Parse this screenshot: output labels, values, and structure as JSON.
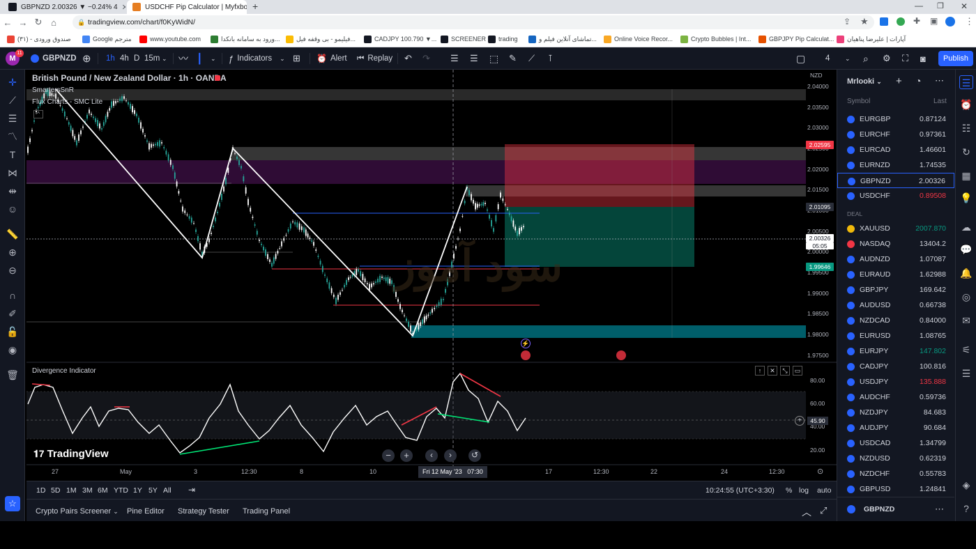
{
  "browser": {
    "tabs": [
      {
        "title": "GBPNZD 2.00326 ▼ −0.24% 4",
        "active": false
      },
      {
        "title": "USDCHF Pip Calculator | Myfxboo",
        "active": true
      }
    ],
    "url": "tradingview.com/chart/f0KyWidN/",
    "bookmarks": [
      "صندوق ورودی - (۳۱)",
      "Google مترجم",
      "www.youtube.com",
      "ورود به سامانه بانکدا...",
      "فیلیمو - بی وقفه فیل...",
      "CADJPY 100.790 ▼...",
      "SCREENER",
      "trading",
      "تماشای آنلاین فیلم و...",
      "Online Voice Recor...",
      "Crypto Bubbles | Int...",
      "GBPJPY Pip Calculat...",
      "آپارات | علیرضا پناهیان"
    ]
  },
  "header": {
    "avatar_badge": "11",
    "symbol": "GBPNZD",
    "intervals": [
      "1h",
      "4h",
      "D",
      "15m"
    ],
    "indicators_label": "Indicators",
    "alert_label": "Alert",
    "replay_label": "Replay",
    "layout_count": "4",
    "publish_label": "Publish"
  },
  "chart": {
    "title": "British Pound / New Zealand Dollar · 1h · OANDA",
    "indicator1": "SmartersSnR",
    "indicator2": "Flux Charts - SMC Lite",
    "currency": "NZD",
    "watermark": "سود آموز",
    "price_ticks": [
      "2.04000",
      "2.03500",
      "2.03000",
      "2.02500",
      "2.02000",
      "2.01500",
      "2.01000",
      "2.00500",
      "2.00000",
      "1.99500",
      "1.99000",
      "1.98500",
      "1.98000",
      "1.97500"
    ],
    "tags": {
      "stop": "2.02595",
      "entry": "2.01095",
      "current": "2.00326",
      "countdown": "05:05",
      "target": "1.99646"
    },
    "colors": {
      "bull": "#26a69a",
      "bear": "#ffffff",
      "stop_zone": "#f23645",
      "target_zone": "#089981",
      "supply_zone": "#9c27b0",
      "demand_zone": "#00bcd4"
    }
  },
  "oscillator": {
    "title": "Divergence Indicator",
    "value": "45.90",
    "ticks": [
      "80.00",
      "60.00",
      "40.00",
      "20.00"
    ],
    "logo": "TradingView"
  },
  "time_axis": [
    "27",
    "May",
    "3",
    "12:30",
    "8",
    "10",
    "17",
    "12:30",
    "22",
    "24",
    "12:30"
  ],
  "crosshair_time": "Fri 12 May '23   07:30",
  "timeframes": [
    "1D",
    "5D",
    "1M",
    "3M",
    "6M",
    "YTD",
    "1Y",
    "5Y",
    "All"
  ],
  "clock": "10:24:55 (UTC+3:30)",
  "scale_opts": [
    "%",
    "log",
    "auto"
  ],
  "bottom_tabs": [
    "Crypto Pairs Screener",
    "Pine Editor",
    "Strategy Tester",
    "Trading Panel"
  ],
  "watchlist": {
    "name": "Mrlooki",
    "col_symbol": "Symbol",
    "col_last": "Last",
    "section_label": "DEAL",
    "footer_symbol": "GBPNZD",
    "rows1": [
      {
        "sym": "EURGBP",
        "last": "0.87124",
        "color": "#d1d4dc"
      },
      {
        "sym": "EURCHF",
        "last": "0.97361",
        "color": "#d1d4dc"
      },
      {
        "sym": "EURCAD",
        "last": "1.46601",
        "color": "#d1d4dc"
      },
      {
        "sym": "EURNZD",
        "last": "1.74535",
        "color": "#d1d4dc"
      },
      {
        "sym": "GBPNZD",
        "last": "2.00326",
        "color": "#d1d4dc"
      },
      {
        "sym": "USDCHF",
        "last": "0.89508",
        "color": "#f23645"
      }
    ],
    "rows2": [
      {
        "sym": "XAUUSD",
        "last": "2007.870",
        "color": "#089981"
      },
      {
        "sym": "NASDAQ",
        "last": "13404.2",
        "color": "#d1d4dc"
      },
      {
        "sym": "AUDNZD",
        "last": "1.07087",
        "color": "#d1d4dc"
      },
      {
        "sym": "EURAUD",
        "last": "1.62988",
        "color": "#d1d4dc"
      },
      {
        "sym": "GBPJPY",
        "last": "169.642",
        "color": "#d1d4dc"
      },
      {
        "sym": "AUDUSD",
        "last": "0.66738",
        "color": "#d1d4dc"
      },
      {
        "sym": "NZDCAD",
        "last": "0.84000",
        "color": "#d1d4dc"
      },
      {
        "sym": "EURUSD",
        "last": "1.08765",
        "color": "#d1d4dc"
      },
      {
        "sym": "EURJPY",
        "last": "147.802",
        "color": "#089981"
      },
      {
        "sym": "CADJPY",
        "last": "100.816",
        "color": "#d1d4dc"
      },
      {
        "sym": "USDJPY",
        "last": "135.888",
        "color": "#f23645"
      },
      {
        "sym": "AUDCHF",
        "last": "0.59736",
        "color": "#d1d4dc"
      },
      {
        "sym": "NZDJPY",
        "last": "84.683",
        "color": "#d1d4dc"
      },
      {
        "sym": "AUDJPY",
        "last": "90.684",
        "color": "#d1d4dc"
      },
      {
        "sym": "USDCAD",
        "last": "1.34799",
        "color": "#d1d4dc"
      },
      {
        "sym": "NZDUSD",
        "last": "0.62319",
        "color": "#d1d4dc"
      },
      {
        "sym": "NZDCHF",
        "last": "0.55783",
        "color": "#d1d4dc"
      },
      {
        "sym": "GBPUSD",
        "last": "1.24841",
        "color": "#d1d4dc"
      }
    ]
  }
}
